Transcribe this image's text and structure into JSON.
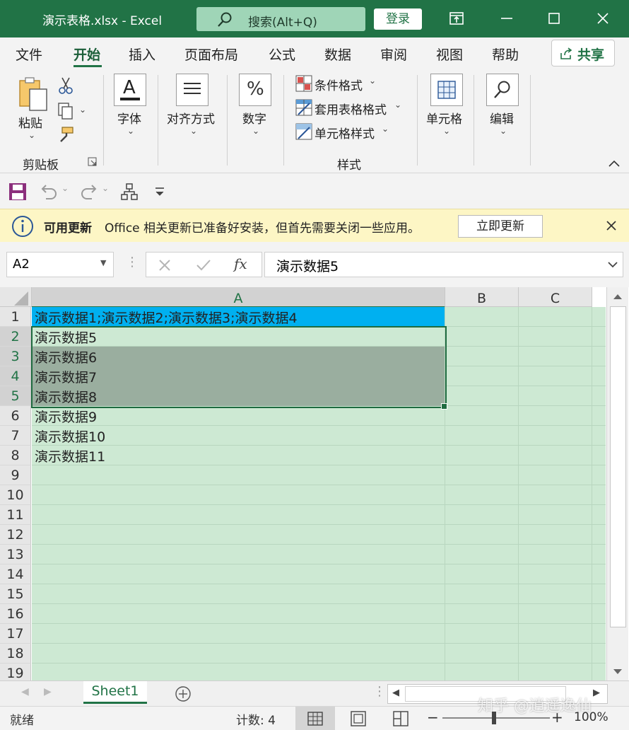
{
  "titlebar": {
    "title": "演示表格.xlsx  -  Excel",
    "search_placeholder": "搜索(Alt+Q)",
    "login_label": "登录"
  },
  "tabs": [
    {
      "label": "文件"
    },
    {
      "label": "开始",
      "active": true
    },
    {
      "label": "插入"
    },
    {
      "label": "页面布局"
    },
    {
      "label": "公式"
    },
    {
      "label": "数据"
    },
    {
      "label": "审阅"
    },
    {
      "label": "视图"
    },
    {
      "label": "帮助"
    }
  ],
  "share_label": "共享",
  "ribbon": {
    "paste_label": "粘贴",
    "clipboard_label": "剪贴板",
    "font_label": "字体",
    "align_label": "对齐方式",
    "number_label": "数字",
    "cond_format_label": "条件格式",
    "table_format_label": "套用表格格式",
    "cell_style_label": "单元格样式",
    "styles_label": "样式",
    "cells_label": "单元格",
    "edit_label": "编辑"
  },
  "infobar": {
    "heading": "可用更新",
    "message": "Office 相关更新已准备好安装，但首先需要关闭一些应用。",
    "button": "立即更新"
  },
  "formula_bar": {
    "name_box": "A2",
    "formula": "演示数据5"
  },
  "grid": {
    "columns": [
      "A",
      "B",
      "C"
    ],
    "rows": [
      "1",
      "2",
      "3",
      "4",
      "5",
      "6",
      "7",
      "8",
      "9",
      "10",
      "11",
      "12",
      "13",
      "14",
      "15",
      "16",
      "17",
      "18",
      "19"
    ],
    "cells": [
      "演示数据1;演示数据2;演示数据3;演示数据4",
      "演示数据5",
      "演示数据6",
      "演示数据7",
      "演示数据8",
      "演示数据9",
      "演示数据10",
      "演示数据11"
    ]
  },
  "sheet_tab": "Sheet1",
  "statusbar": {
    "ready": "就绪",
    "count": "计数: 4",
    "zoom": "100%"
  },
  "watermark": "知乎 @逍遥逸仙",
  "colors": {
    "excel_green": "#217346",
    "cell_bg": "#cde9d3",
    "selected_cell": "#9aae9f",
    "header_cell": "#00b0f0",
    "infobar_bg": "#fdf6c5"
  }
}
